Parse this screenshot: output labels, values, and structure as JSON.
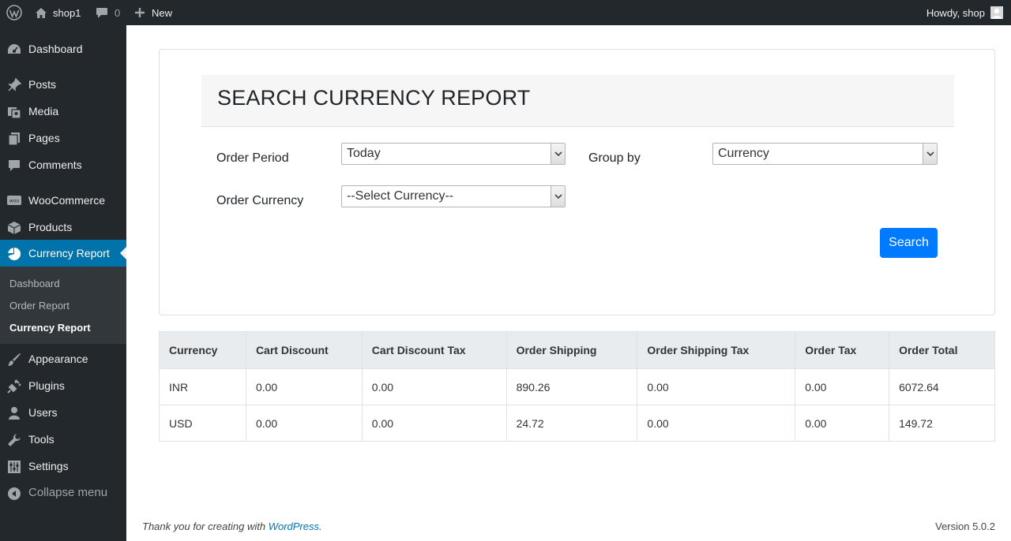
{
  "admin_bar": {
    "site_name": "shop1",
    "comment_count": "0",
    "new_label": "New",
    "greeting": "Howdy, shop"
  },
  "sidebar": {
    "items": [
      {
        "label": "Dashboard",
        "icon": "dashboard-icon"
      },
      {
        "label": "Posts",
        "icon": "pin-icon"
      },
      {
        "label": "Media",
        "icon": "media-icon"
      },
      {
        "label": "Pages",
        "icon": "pages-icon"
      },
      {
        "label": "Comments",
        "icon": "comment-icon"
      },
      {
        "label": "WooCommerce",
        "icon": "woo-icon"
      },
      {
        "label": "Products",
        "icon": "box-icon"
      },
      {
        "label": "Currency Report",
        "icon": "pie-chart-icon",
        "current": true
      },
      {
        "label": "Appearance",
        "icon": "brush-icon"
      },
      {
        "label": "Plugins",
        "icon": "plug-icon"
      },
      {
        "label": "Users",
        "icon": "user-icon"
      },
      {
        "label": "Tools",
        "icon": "wrench-icon"
      },
      {
        "label": "Settings",
        "icon": "sliders-icon"
      }
    ],
    "submenu": [
      "Dashboard",
      "Order Report",
      "Currency Report"
    ],
    "collapse_label": "Collapse menu"
  },
  "search_form": {
    "title": "SEARCH CURRENCY REPORT",
    "order_period_label": "Order Period",
    "order_period_value": "Today",
    "group_by_label": "Group by",
    "group_by_value": "Currency",
    "order_currency_label": "Order Currency",
    "order_currency_value": "--Select Currency--",
    "search_label": "Search"
  },
  "table": {
    "headers": [
      "Currency",
      "Cart Discount",
      "Cart Discount Tax",
      "Order Shipping",
      "Order Shipping Tax",
      "Order Tax",
      "Order Total"
    ],
    "rows": [
      [
        "INR",
        "0.00",
        "0.00",
        "890.26",
        "0.00",
        "0.00",
        "6072.64"
      ],
      [
        "USD",
        "0.00",
        "0.00",
        "24.72",
        "0.00",
        "0.00",
        "149.72"
      ]
    ]
  },
  "footer": {
    "thanks_prefix": "Thank you for creating with ",
    "wp_link": "WordPress",
    "thanks_suffix": ".",
    "version": "Version 5.0.2"
  },
  "colors": {
    "admin_bg": "#23282d",
    "accent": "#0073aa",
    "primary_button": "#007bff"
  }
}
